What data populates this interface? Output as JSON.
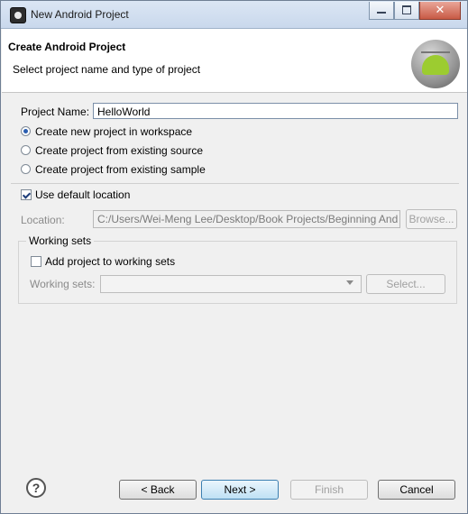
{
  "window": {
    "title": "New Android Project"
  },
  "header": {
    "title": "Create Android Project",
    "subtitle": "Select project name and type of project"
  },
  "project": {
    "name_label": "Project Name:",
    "name_value": "HelloWorld",
    "options": [
      {
        "label": "Create new project in workspace",
        "selected": true
      },
      {
        "label": "Create project from existing source",
        "selected": false
      },
      {
        "label": "Create project from existing sample",
        "selected": false
      }
    ]
  },
  "location": {
    "use_default_label": "Use default location",
    "use_default_checked": true,
    "label": "Location:",
    "value": "C:/Users/Wei-Meng Lee/Desktop/Book Projects/Beginning And",
    "browse_label": "Browse..."
  },
  "working_sets": {
    "group_label": "Working sets",
    "add_label": "Add project to working sets",
    "add_checked": false,
    "sets_label": "Working sets:",
    "sets_value": "",
    "select_label": "Select..."
  },
  "footer": {
    "back": "< Back",
    "next": "Next >",
    "finish": "Finish",
    "cancel": "Cancel",
    "help_icon_glyph": "?"
  },
  "colors": {
    "accent": "#3c7fb1",
    "android_green": "#9ccc30"
  }
}
